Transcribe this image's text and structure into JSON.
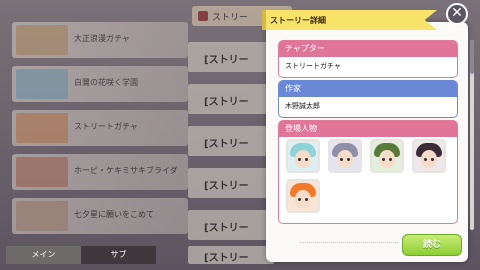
{
  "background": {
    "story_list": [
      {
        "label": "大正浪漫ガチャ",
        "thumb_color": "#caa67a"
      },
      {
        "label": "白鷺の花咲く学園",
        "thumb_color": "#8fb9c8"
      },
      {
        "label": "ストリートガチャ",
        "thumb_color": "#d99a6a"
      },
      {
        "label": "ホーピ・ケキミサキブライダ",
        "thumb_color": "#c88a70"
      },
      {
        "label": "七夕星に願いをこめて",
        "thumb_color": "#c7a78c"
      }
    ],
    "tabs": {
      "main": "メイン",
      "sub": "サブ"
    },
    "middle_title": "ストリー",
    "middle_rows": [
      "[ストリー",
      "[ストリー",
      "[ストリー",
      "[ストリー",
      "[ストリー",
      "[ストリー"
    ]
  },
  "dialog": {
    "title": "ストーリー詳細",
    "close_glyph": "✕",
    "chapter": {
      "label": "チャプター",
      "value": "ストリートガチャ",
      "color": "#e0759a"
    },
    "author": {
      "label": "作家",
      "value": "木野誠太郎",
      "color": "#6a88d6"
    },
    "characters": {
      "label": "登場人物",
      "portraits": [
        {
          "name": "character-1",
          "hair": "#8fd3d7"
        },
        {
          "name": "character-2",
          "hair": "#8f8fa8"
        },
        {
          "name": "character-3",
          "hair": "#5a7a3a"
        },
        {
          "name": "character-4",
          "hair": "#3a2b35"
        },
        {
          "name": "character-5",
          "hair": "#f07a2a"
        }
      ]
    },
    "read_button": "読む"
  }
}
